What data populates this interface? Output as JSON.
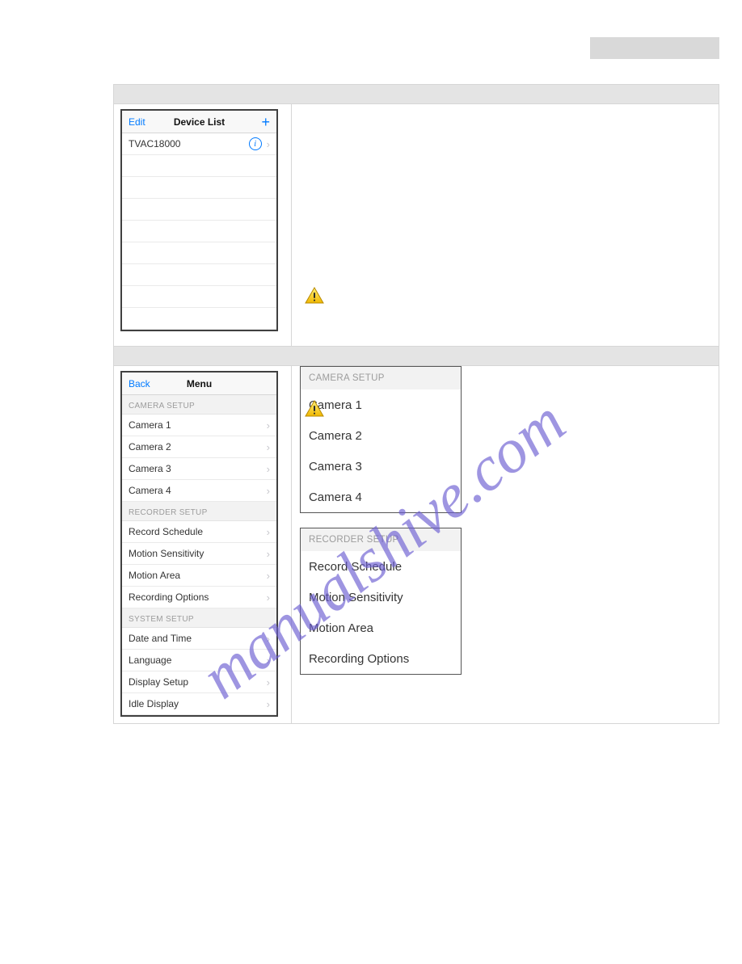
{
  "screen1": {
    "navbar": {
      "left": "Edit",
      "title": "Device List",
      "addGlyph": "+"
    },
    "rows": [
      {
        "label": "TVAC18000",
        "hasInfo": true
      }
    ],
    "blankRowCount": 8
  },
  "screen2": {
    "navbar": {
      "left": "Back",
      "title": "Menu"
    },
    "sections": [
      {
        "header": "CAMERA SETUP",
        "items": [
          "Camera 1",
          "Camera 2",
          "Camera 3",
          "Camera 4"
        ]
      },
      {
        "header": "RECORDER SETUP",
        "items": [
          "Record Schedule",
          "Motion Sensitivity",
          "Motion Area",
          "Recording Options"
        ]
      },
      {
        "header": "SYSTEM SETUP",
        "items": [
          "Date and Time",
          "Language",
          "Display Setup",
          "Idle Display"
        ]
      }
    ]
  },
  "rightPanels": [
    {
      "header": "CAMERA SETUP",
      "items": [
        "Camera 1",
        "Camera 2",
        "Camera 3",
        "Camera 4"
      ]
    },
    {
      "header": "RECORDER SETUP",
      "items": [
        "Record Schedule",
        "Motion Sensitivity",
        "Motion Area",
        "Recording Options"
      ]
    }
  ],
  "watermarkText": "manualshive.com"
}
